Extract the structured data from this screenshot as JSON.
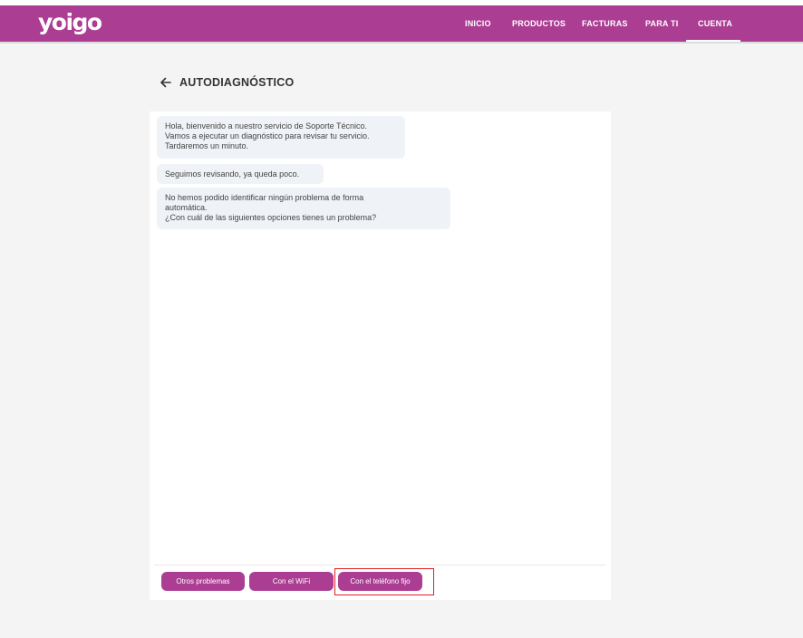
{
  "brand": {
    "logo_text": "yoigo",
    "accent_color": "#ab3d93"
  },
  "nav": {
    "items": [
      {
        "label": "INICIO"
      },
      {
        "label": "PRODUCTOS"
      },
      {
        "label": "FACTURAS"
      },
      {
        "label": "PARA TI"
      },
      {
        "label": "CUENTA",
        "active": true
      }
    ]
  },
  "page": {
    "title": "AUTODIAGNÓSTICO",
    "back_icon": "arrow-left-icon"
  },
  "chat": {
    "messages": [
      {
        "text": "Hola, bienvenido a nuestro servicio de Soporte Técnico.\nVamos a ejecutar un diagnóstico para revisar tu servicio.\nTardaremos un minuto."
      },
      {
        "text": "Seguimos revisando, ya queda poco."
      },
      {
        "text": "No hemos podido identificar ningún problema de forma\nautomática.\n¿Con cuál de las siguientes opciones tienes un problema?"
      }
    ],
    "options": [
      {
        "label": "Otros problemas"
      },
      {
        "label": "Con el WiFi"
      },
      {
        "label": "Con el teléfono fijo",
        "highlighted": true
      }
    ]
  }
}
